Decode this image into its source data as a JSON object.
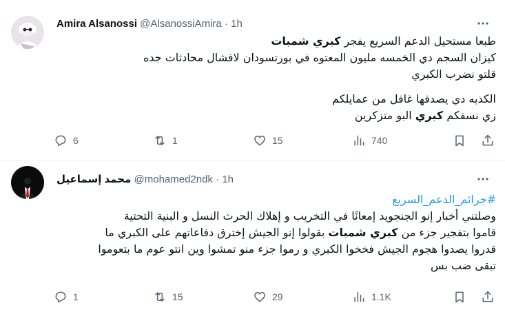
{
  "tweets": [
    {
      "author_name": "Amira Alsanossi",
      "handle": "@AlsanossiAmira",
      "separator": "·",
      "time": "1h",
      "lines": [
        {
          "pre": "طبعا مستحيل الدعم السريع يفجر ",
          "bold": "كبري شمبات",
          "post": ""
        },
        {
          "pre": "كيزان السجم دي الخمسه مليون المعتوه في بورتسودان لافشال محادثات جده",
          "bold": "",
          "post": ""
        },
        {
          "pre": "قلتو نضرب الكبري",
          "bold": "",
          "post": ""
        },
        {
          "pre": "الكذبه دي يصدقها غافل من عمايلكم",
          "bold": "",
          "post": ""
        },
        {
          "pre": "زي نسفكم ",
          "bold": "كبري",
          "post": " البو متزكرين"
        }
      ],
      "stats": {
        "replies": "6",
        "retweets": "1",
        "likes": "15",
        "views": "740"
      }
    },
    {
      "author_name": "محمد إسماعيل",
      "handle": "@mohamed2ndk",
      "separator": "·",
      "time": "1h",
      "hashtag": "#جرائم_الدعم_السريع",
      "lines": [
        {
          "pre": "وصلتني أخبار إنو الجنجويد إمعانًا في التخريب و إهلاك الحرث النسل و البنية التحتية",
          "bold": "",
          "post": ""
        },
        {
          "pre": "قاموا بتفجير جزء من ",
          "bold": "كبري شمبات",
          "post": " بقولوا إنو الجيش إخترق دفاعاتهم على الكبري ما"
        },
        {
          "pre": "قدروا يصدوا هجوم الجيش فخخوا الكبري و رموا جزء منو تمشوا وين انتو عوم ما بتعوموا",
          "bold": "",
          "post": ""
        },
        {
          "pre": "تبقى ضب بس",
          "bold": "",
          "post": ""
        }
      ],
      "stats": {
        "replies": "1",
        "retweets": "15",
        "likes": "29",
        "views": "1.1K"
      }
    }
  ],
  "icons": {
    "reply": "reply-icon",
    "retweet": "retweet-icon",
    "like": "heart-icon",
    "views": "views-icon",
    "bookmark": "bookmark-icon",
    "share": "share-icon",
    "more": "more-icon"
  },
  "colors": {
    "text": "#0f1419",
    "secondary": "#536471",
    "link": "#1d9bf0",
    "divider": "#eff3f4"
  }
}
